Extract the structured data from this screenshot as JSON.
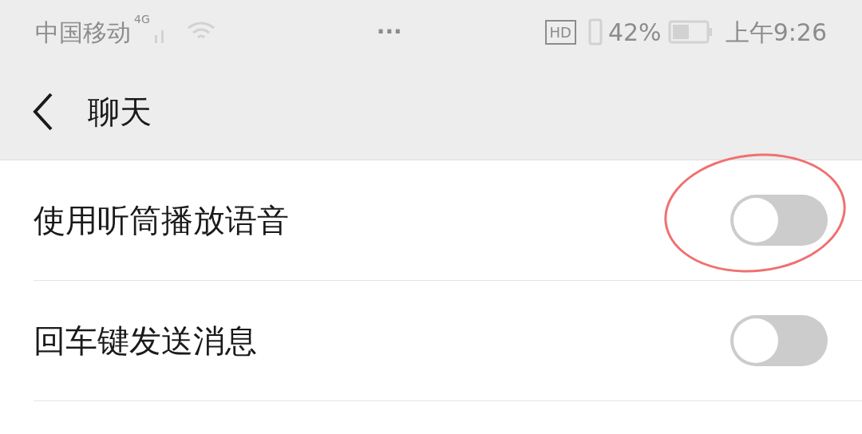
{
  "status_bar": {
    "carrier": "中国移动",
    "network": "4G",
    "more": "···",
    "hd": "HD",
    "battery": "42%",
    "time": "上午9:26"
  },
  "header": {
    "title": "聊天"
  },
  "settings": [
    {
      "label": "使用听筒播放语音",
      "on": false,
      "highlighted": true
    },
    {
      "label": "回车键发送消息",
      "on": false,
      "highlighted": false
    }
  ]
}
